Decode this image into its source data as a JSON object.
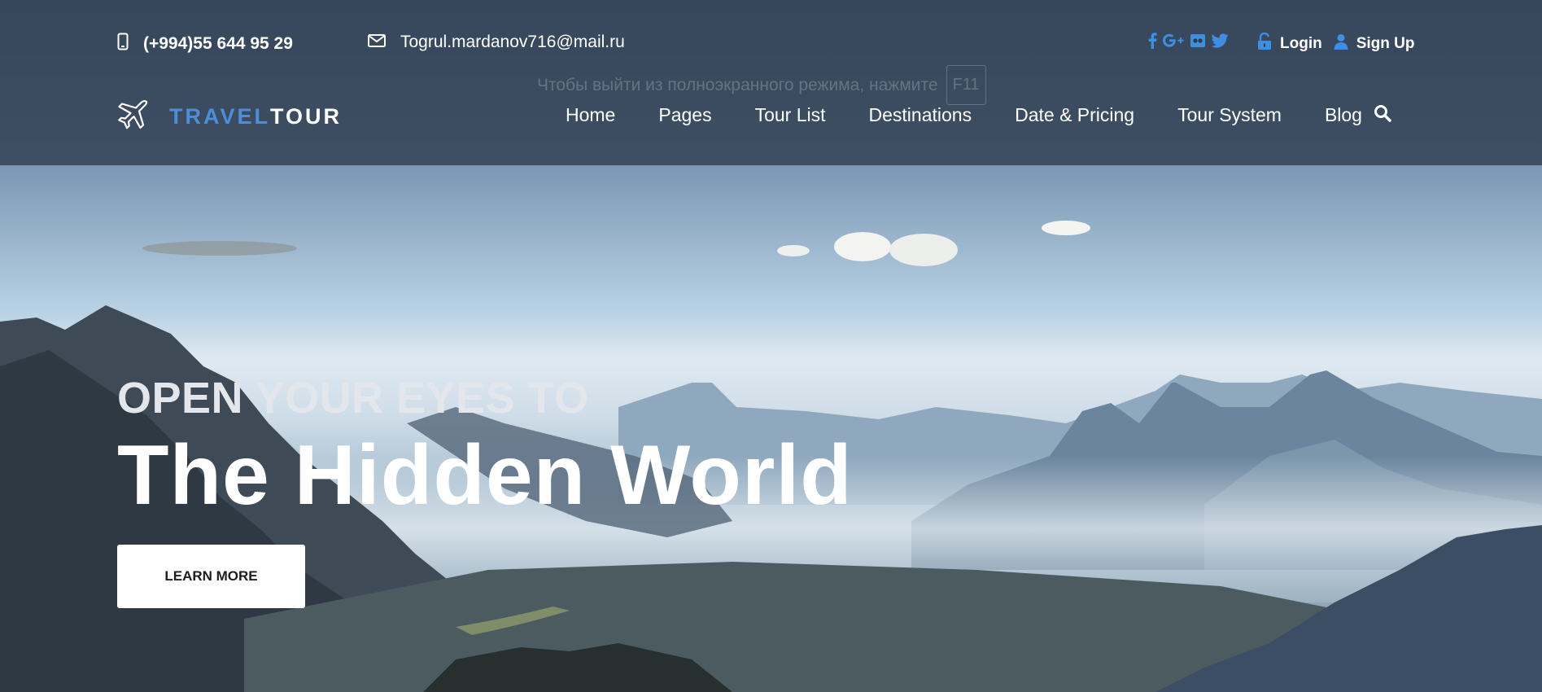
{
  "topbar": {
    "phone": "(+994)55 644 95 29",
    "email": "Togrul.mardanov716@mail.ru",
    "social_icons": [
      "facebook-icon",
      "google-plus-icon",
      "flickr-icon",
      "twitter-icon"
    ],
    "login": "Login",
    "signup": "Sign Up"
  },
  "fullscreen_hint": {
    "text": "Чтобы выйти из полноэкранного режима, нажмите",
    "key": "F11"
  },
  "logo": {
    "part1": "TRAVEL",
    "part2": "TOUR"
  },
  "nav": {
    "items": [
      "Home",
      "Pages",
      "Tour List",
      "Destinations",
      "Date & Pricing",
      "Tour System",
      "Blog"
    ]
  },
  "hero": {
    "eyebrow": "OPEN YOUR EYES TO",
    "headline": "The Hidden World",
    "cta": "LEARN MORE"
  },
  "colors": {
    "accent_blue": "#4e8ed8",
    "social_blue": "#3f8ee0",
    "header_overlay": "#2d3a4b",
    "text_white": "#ffffff"
  }
}
